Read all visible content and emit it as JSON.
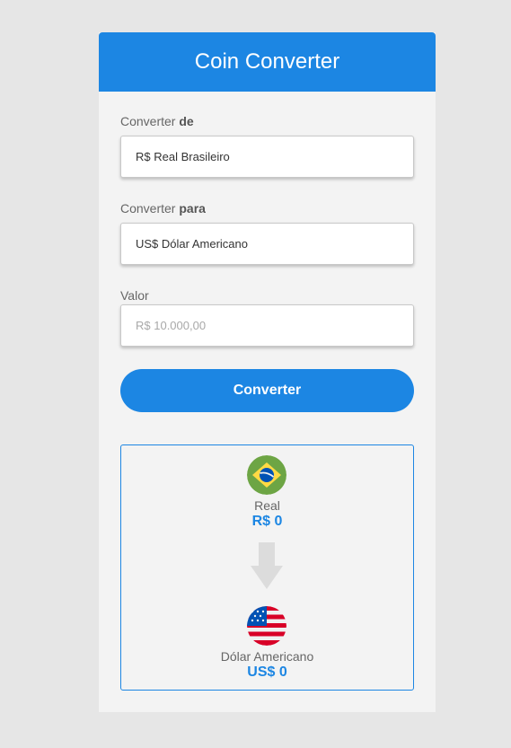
{
  "header": {
    "title": "Coin Converter"
  },
  "form": {
    "from": {
      "label_prefix": "Converter",
      "label_bold": "de",
      "value": "R$ Real Brasileiro"
    },
    "to": {
      "label_prefix": "Converter",
      "label_bold": "para",
      "value": "US$ Dólar Americano"
    },
    "amount": {
      "label": "Valor",
      "placeholder": "R$ 10.000,00"
    },
    "convert_label": "Converter"
  },
  "result": {
    "source": {
      "name": "Real",
      "value": "R$ 0",
      "flag_icon": "brazil-flag-icon"
    },
    "target": {
      "name": "Dólar Americano",
      "value": "US$ 0",
      "flag_icon": "usa-flag-icon"
    },
    "arrow_icon": "arrow-down-icon"
  },
  "colors": {
    "primary": "#1c86e3",
    "background": "#e6e6e6",
    "card": "#f3f3f3"
  }
}
